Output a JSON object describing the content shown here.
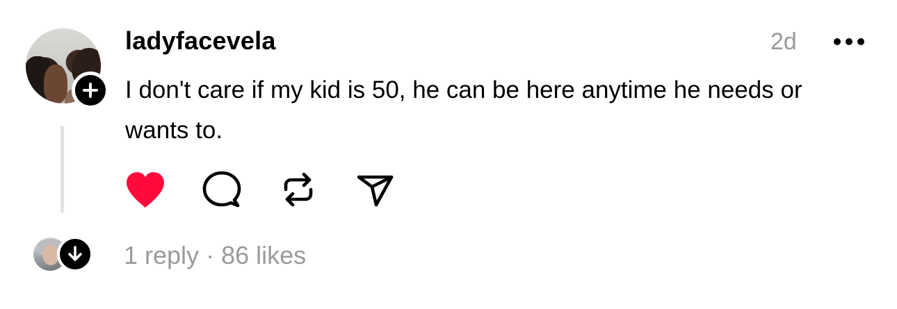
{
  "post": {
    "username": "ladyfacevela",
    "timestamp": "2d",
    "text": "I don't care if my kid is 50, he can be here anytime he needs or wants to.",
    "liked": true,
    "colors": {
      "like": "#ff0a3c",
      "muted": "#9a9a9a",
      "thread_line": "#e3e3e3"
    },
    "icons": {
      "more": "more-horizontal-icon",
      "like": "heart-icon",
      "comment": "comment-bubble-icon",
      "repost": "repost-icon",
      "share": "send-icon",
      "follow": "plus-icon",
      "expand": "arrow-down-icon"
    }
  },
  "footer": {
    "replies": "1 reply",
    "separator": "·",
    "likes": "86 likes"
  }
}
